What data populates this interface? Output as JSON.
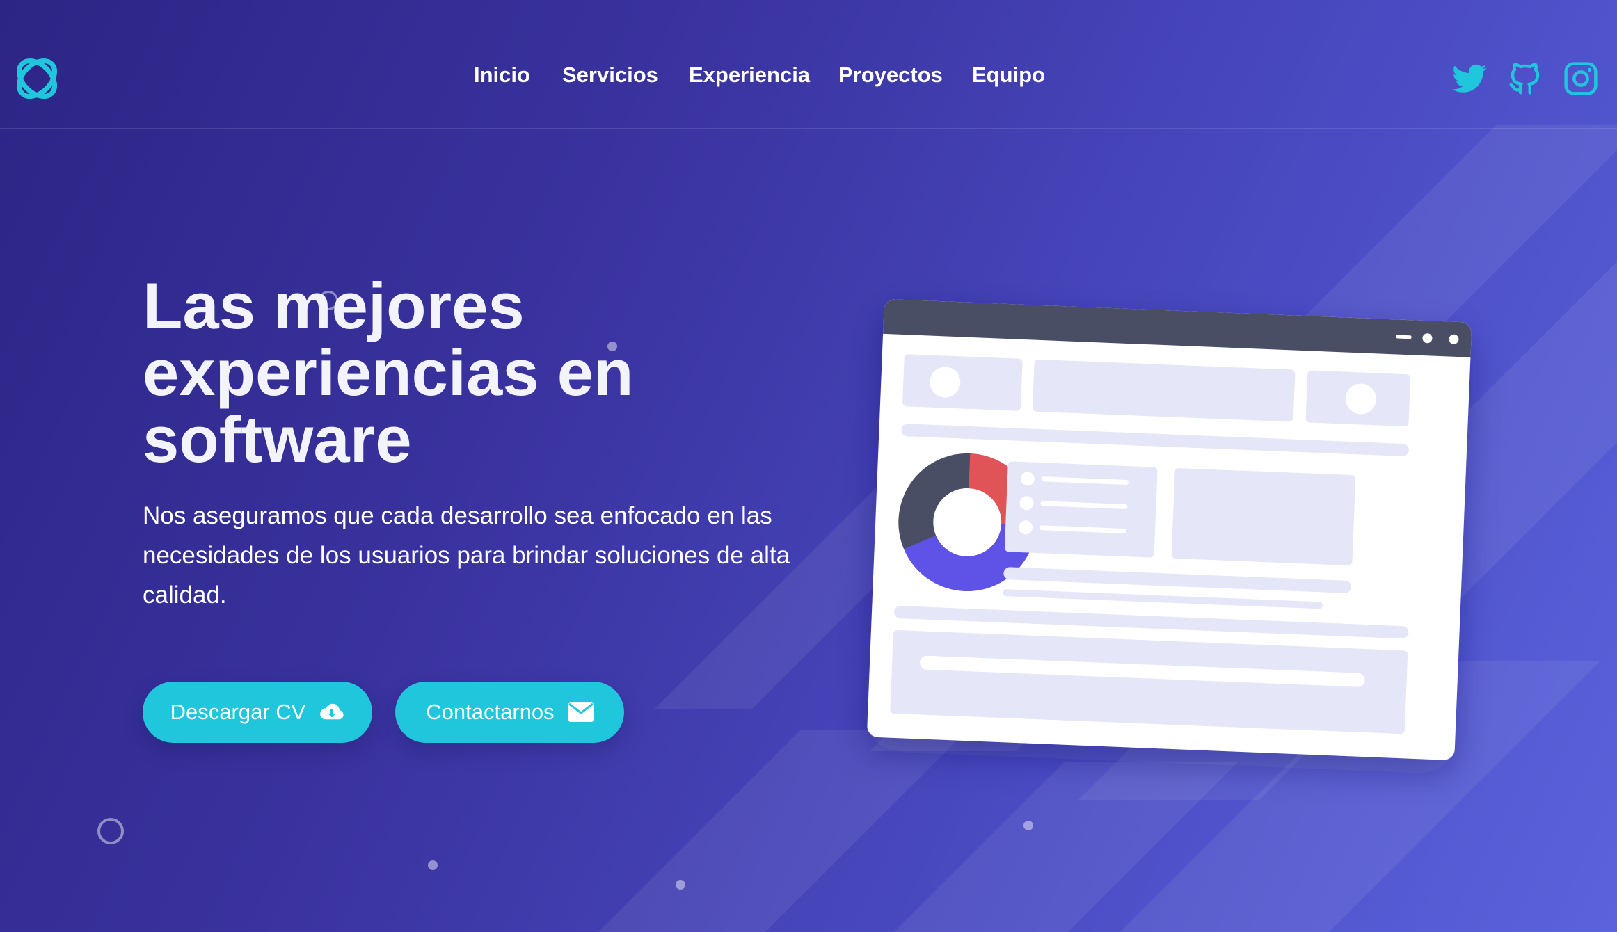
{
  "nav": {
    "items": [
      {
        "label": "Inicio"
      },
      {
        "label": "Servicios"
      },
      {
        "label": "Experiencia"
      },
      {
        "label": "Proyectos"
      },
      {
        "label": "Equipo"
      }
    ]
  },
  "social": {
    "icons": [
      "twitter-icon",
      "github-icon",
      "instagram-icon"
    ],
    "color": "#1fc6dc"
  },
  "hero": {
    "title_line1": "Las mejores",
    "title_line2": "experiencias en",
    "title_line3": "software",
    "description": "Nos aseguramos que cada desarrollo sea enfocado en las necesidades de los usuarios para brindar soluciones de alta calidad."
  },
  "buttons": {
    "download_label": "Descargar CV",
    "contact_label": "Contactarnos"
  },
  "colors": {
    "accent": "#1fc6dc",
    "bg_start": "#2c2585",
    "bg_end": "#5a63dc",
    "donut_red": "#e05357",
    "donut_purple": "#5f52e6",
    "donut_dark": "#4a4e64"
  }
}
